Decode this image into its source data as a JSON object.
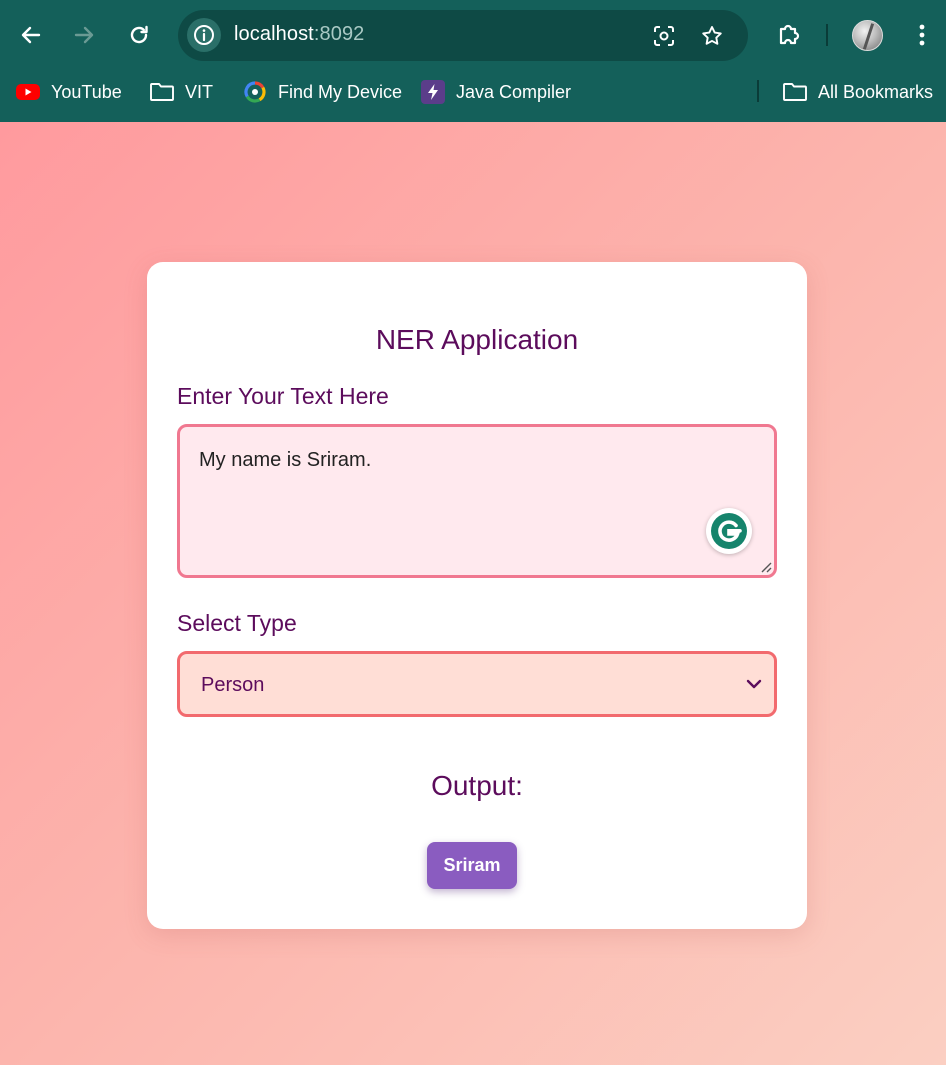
{
  "browser": {
    "url_host": "localhost",
    "url_port": ":8092",
    "bookmarks": [
      {
        "label": "YouTube",
        "icon": "youtube-icon"
      },
      {
        "label": "VIT",
        "icon": "folder-icon"
      },
      {
        "label": "Find My Device",
        "icon": "find-my-device-icon"
      },
      {
        "label": "Java Compiler",
        "icon": "lightning-icon"
      }
    ],
    "all_bookmarks_label": "All Bookmarks",
    "colors": {
      "frame": "#14605a",
      "omnibox": "#0e4a45"
    }
  },
  "app": {
    "title": "NER Application",
    "text_label": "Enter Your Text Here",
    "text_value": "My name is Sriram.",
    "type_label": "Select Type",
    "type_selected": "Person",
    "output_title": "Output:",
    "output_entities": [
      "Sriram"
    ],
    "colors": {
      "heading": "#5c0c5c",
      "entity_chip": "#8a5cc0",
      "textarea_border": "#f07890",
      "select_border": "#f26a6e"
    }
  }
}
